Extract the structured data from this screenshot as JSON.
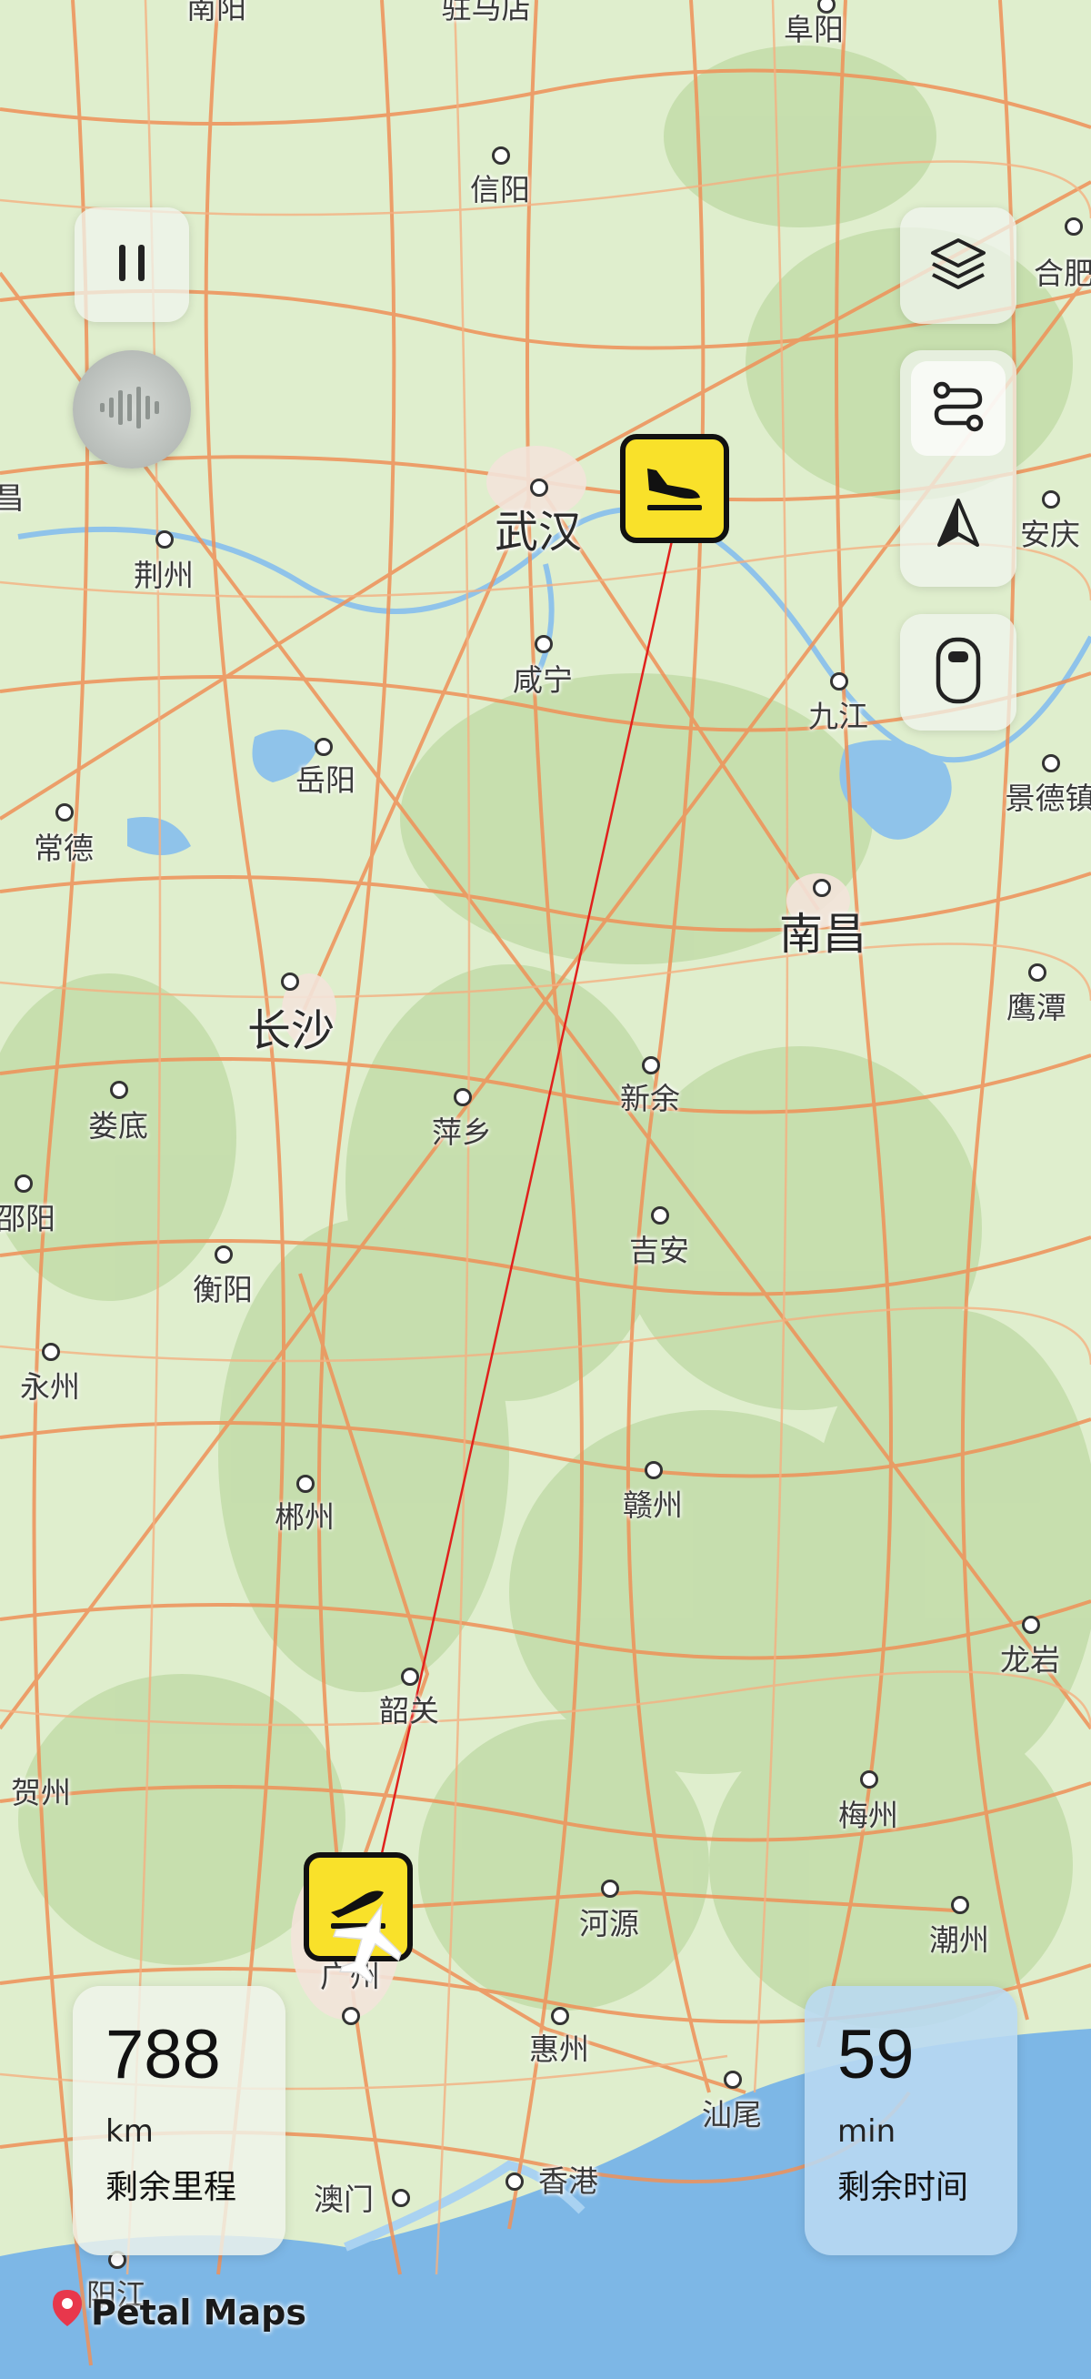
{
  "colors": {
    "land": "#dfeecd",
    "road": "#ef9158",
    "water": "#8fc3ea",
    "sea": "#7db7e6",
    "forest": "#bfdaa7",
    "route": "#e0211d",
    "airport": "#f9e12a"
  },
  "cities": [
    {
      "name": "南阳"
    },
    {
      "name": "驻马店"
    },
    {
      "name": "阜阳"
    },
    {
      "name": "信阳"
    },
    {
      "name": "合肥"
    },
    {
      "name": "荆州"
    },
    {
      "name": "武汉"
    },
    {
      "name": "安庆"
    },
    {
      "name": "咸宁"
    },
    {
      "name": "九江"
    },
    {
      "name": "岳阳"
    },
    {
      "name": "常德"
    },
    {
      "name": "景德镇"
    },
    {
      "name": "南昌"
    },
    {
      "name": "长沙"
    },
    {
      "name": "鹰潭"
    },
    {
      "name": "娄底"
    },
    {
      "name": "萍乡"
    },
    {
      "name": "新余"
    },
    {
      "name": "邵阳"
    },
    {
      "name": "吉安"
    },
    {
      "name": "衡阳"
    },
    {
      "name": "永州"
    },
    {
      "name": "郴州"
    },
    {
      "name": "赣州"
    },
    {
      "name": "龙岩"
    },
    {
      "name": "韶关"
    },
    {
      "name": "贺州"
    },
    {
      "name": "梅州"
    },
    {
      "name": "河源"
    },
    {
      "name": "潮州"
    },
    {
      "name": "广州"
    },
    {
      "name": "惠州"
    },
    {
      "name": "汕尾"
    },
    {
      "name": "香港"
    },
    {
      "name": "澳门"
    },
    {
      "name": "阳江"
    },
    {
      "name": "昌"
    }
  ],
  "controls": {
    "pause": "pause-icon",
    "voice": "voice-icon",
    "layers": "layers-icon",
    "route": "route-icon",
    "compass": "navigation-arrow-icon",
    "window": "aircraft-window-icon"
  },
  "stats": {
    "distance": {
      "value": "788",
      "unit": "km",
      "label": "剩余里程"
    },
    "time": {
      "value": "59",
      "unit": "min",
      "label": "剩余时间"
    }
  },
  "brand": {
    "name": "Petal Maps"
  }
}
